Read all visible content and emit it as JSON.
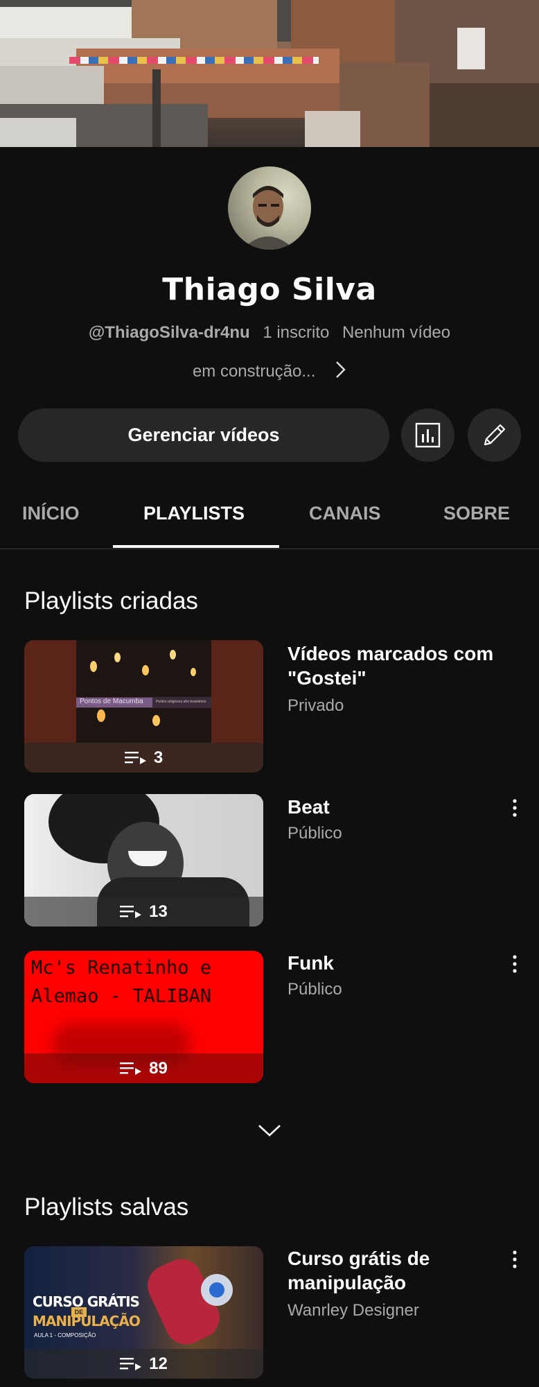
{
  "channel": {
    "name": "Thiago Silva",
    "handle": "@ThiagoSilva-dr4nu",
    "subscribers": "1 inscrito",
    "videos": "Nenhum vídeo",
    "description": "em construção..."
  },
  "actions": {
    "manage_label": "Gerenciar vídeos",
    "analytics_icon": "analytics-icon",
    "edit_icon": "pencil-icon"
  },
  "tabs": [
    {
      "label": "INÍCIO",
      "active": false
    },
    {
      "label": "PLAYLISTS",
      "active": true
    },
    {
      "label": "CANAIS",
      "active": false
    },
    {
      "label": "SOBRE",
      "active": false
    }
  ],
  "created_section": {
    "title": "Playlists criadas",
    "playlists": [
      {
        "title": "Vídeos marcados com \"Gostei\"",
        "privacy": "Privado",
        "count": "3",
        "thumb_caption": "Pontos de Macumba",
        "thumb_sub": "Pontos religiosos afro-brasileiros"
      },
      {
        "title": "Beat",
        "privacy": "Público",
        "count": "13"
      },
      {
        "title": "Funk",
        "privacy": "Público",
        "count": "89",
        "thumb_text": "Mc's Renatinho e Alemao - TALIBAN"
      }
    ]
  },
  "saved_section": {
    "title": "Playlists salvas",
    "playlists": [
      {
        "title": "Curso grátis de manipulação",
        "author": "Wanrley Designer",
        "count": "12",
        "thumb_line1": "CURSO GRÁTIS",
        "thumb_de": "DE",
        "thumb_line2": "MANIPULAÇÃO",
        "thumb_line3": "AULA 1 - COMPOSIÇÃO"
      }
    ]
  },
  "colors": {
    "background": "#0f0f0f",
    "button_bg": "#272727",
    "secondary_text": "#aaaaaa",
    "funk_thumb_red": "#ff0000"
  }
}
